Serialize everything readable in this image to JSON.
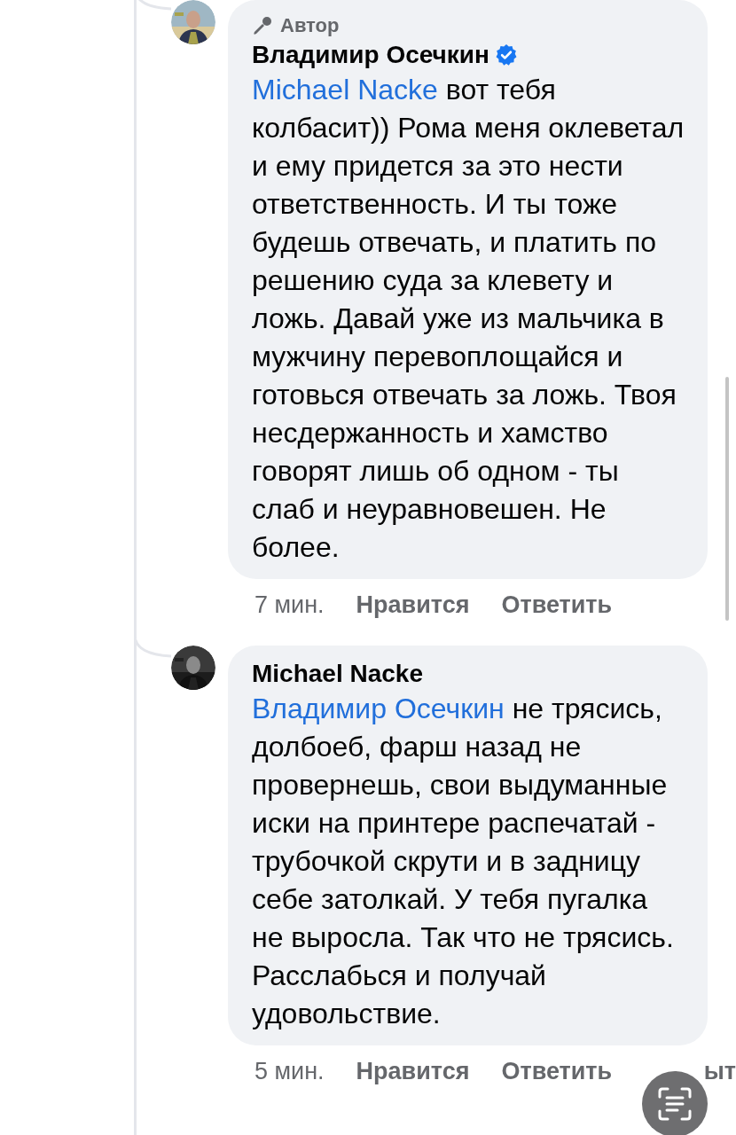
{
  "comments": [
    {
      "author": "Владимир Осечкин",
      "verified": true,
      "badge": "Автор",
      "mention": "Michael Nacke",
      "text": "вот тебя колбасит)) Рома меня оклеветал и ему придется за это нести ответственность. И ты тоже будешь отвечать, и платить по решению суда за клевету и ложь. Давай уже из мальчика в мужчину перевоплощайся и готовься отвечать за ложь. Твоя несдержанность и хамство говорят лишь об одном - ты слаб и неуравновешен. Не более.",
      "avatar": {
        "kind": "picture"
      },
      "actions": [
        {
          "label": "7 мин.",
          "kind": "time"
        },
        {
          "label": "Нравится",
          "kind": "action"
        },
        {
          "label": "Ответить",
          "kind": "action"
        }
      ]
    },
    {
      "author": "Michael Nacke",
      "verified": false,
      "mention": "Владимир Осечкин",
      "text": "не трясись, долбоеб, фарш назад не провернешь, свои выдуманные иски на принтере распечатай - трубочкой скрути и в задницу себе затолкай. У тебя пугалка не выросла. Так что не трясись. Расслабься и получай удовольствие.",
      "avatar": {
        "kind": "picture"
      },
      "actions": [
        {
          "label": "5 мин.",
          "kind": "time"
        },
        {
          "label": "Нравится",
          "kind": "action"
        },
        {
          "label": "Ответить",
          "kind": "action"
        },
        {
          "label": "ыт",
          "kind": "cut"
        }
      ]
    }
  ]
}
